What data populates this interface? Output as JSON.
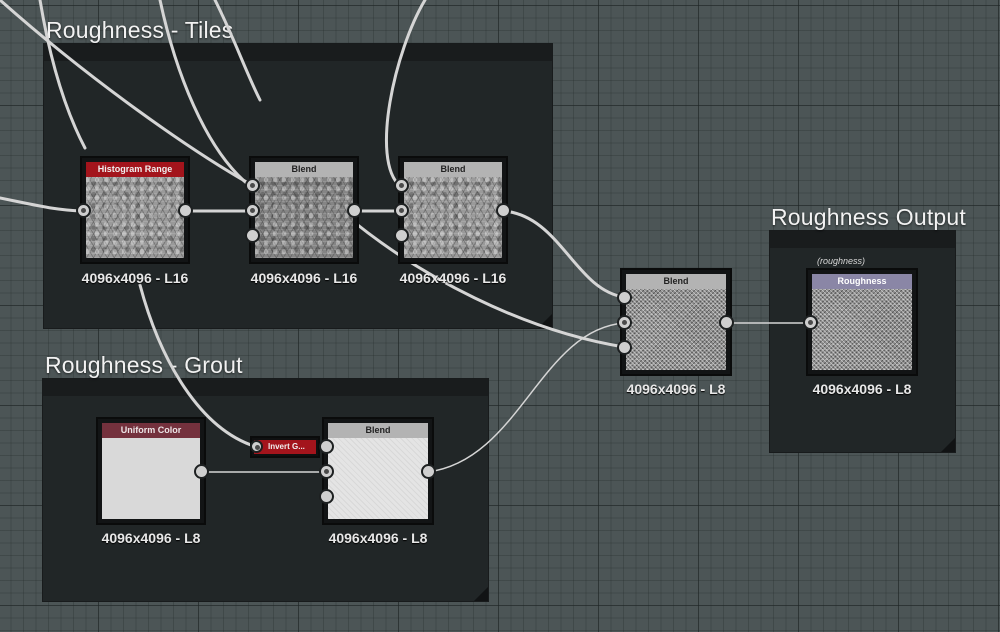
{
  "frames": {
    "tiles": {
      "title": "Roughness - Tiles"
    },
    "grout": {
      "title": "Roughness - Grout"
    },
    "output": {
      "title": "Roughness Output"
    }
  },
  "nodes": {
    "histogram_range": {
      "label": "Histogram Range",
      "caption": "4096x4096 - L16"
    },
    "blend_1": {
      "label": "Blend",
      "caption": "4096x4096 - L16"
    },
    "blend_2": {
      "label": "Blend",
      "caption": "4096x4096 - L16"
    },
    "blend_main": {
      "label": "Blend",
      "caption": "4096x4096 - L8"
    },
    "roughness_output": {
      "label": "Roughness",
      "comment": "(roughness)",
      "caption": "4096x4096 - L8"
    },
    "uniform_color": {
      "label": "Uniform Color",
      "caption": "4096x4096 - L8"
    },
    "invert_grayscale": {
      "label": "Invert G..."
    },
    "blend_grout": {
      "label": "Blend",
      "caption": "4096x4096 - L8"
    }
  },
  "colors": {
    "canvas": "#4c5556",
    "frame": "#212627",
    "wire": "#d5d5d5",
    "header_red": "#a3141c",
    "header_gray": "#b3b3b3",
    "header_output": "#8a86a6",
    "header_uniform": "#74313d"
  }
}
